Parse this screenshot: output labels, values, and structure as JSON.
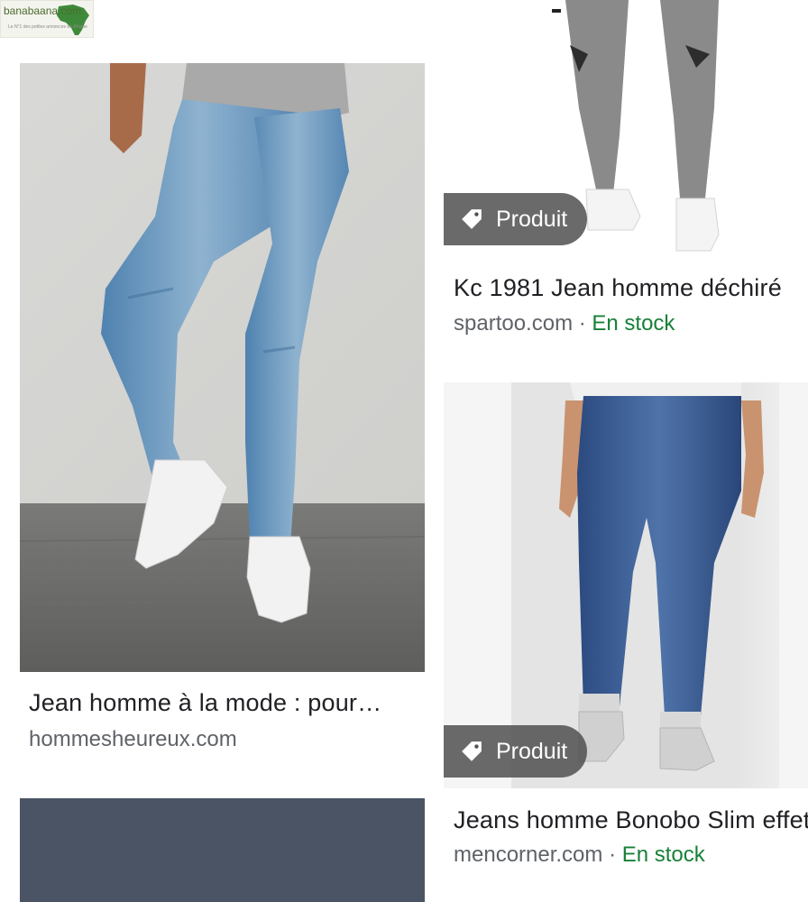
{
  "logo": {
    "text": "banabaana.com",
    "tagline": "Le N°1 des petites annonces en Afrique"
  },
  "results": [
    {
      "title": "Jean homme à la mode : pour…",
      "source": "hommesheureux.com",
      "stock": ""
    },
    {
      "title": "Kc 1981 Jean homme déchiré",
      "source": "spartoo.com",
      "separator": " · ",
      "stock": "En stock",
      "chip": "Produit"
    },
    {
      "title": "Jeans homme Bonobo Slim effet",
      "source": "mencorner.com",
      "separator": " · ",
      "stock": "En stock",
      "chip": "Produit"
    }
  ],
  "colors": {
    "stock": "#188038",
    "chip_bg": "#505050",
    "placeholder": "#4a5464"
  },
  "icons": {
    "chip": "tag-icon"
  }
}
